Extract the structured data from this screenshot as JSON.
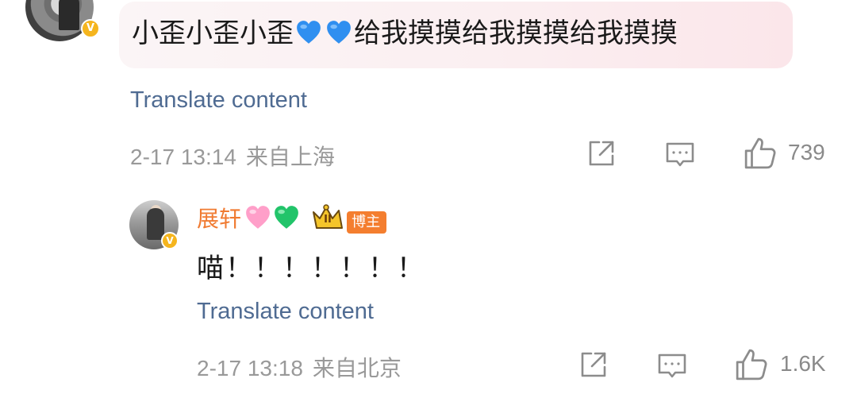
{
  "comment": {
    "text_before": "小歪小歪小歪",
    "text_after": "给我摸摸给我摸摸给我摸摸",
    "emoji": [
      "blue-heart",
      "blue-heart"
    ],
    "translate_label": "Translate content",
    "time": "2-17 13:14",
    "location": "来自上海",
    "like_count": "739",
    "verified_badge": "V"
  },
  "reply": {
    "username": "展轩",
    "emoji": [
      "pink-heart",
      "green-heart"
    ],
    "crown_badge_text": "II",
    "role_tag": "博主",
    "text": "喵！！！！！！！",
    "translate_label": "Translate content",
    "time": "2-17 13:18",
    "location": "来自北京",
    "like_count": "1.6K",
    "verified_badge": "V"
  },
  "colors": {
    "translate_link": "#4f6b92",
    "username": "#f07b32",
    "tag_bg": "#f47e2f",
    "verified": "#f5b51e",
    "meta": "#999999"
  },
  "icons": [
    "share-icon",
    "comment-icon",
    "like-icon"
  ]
}
